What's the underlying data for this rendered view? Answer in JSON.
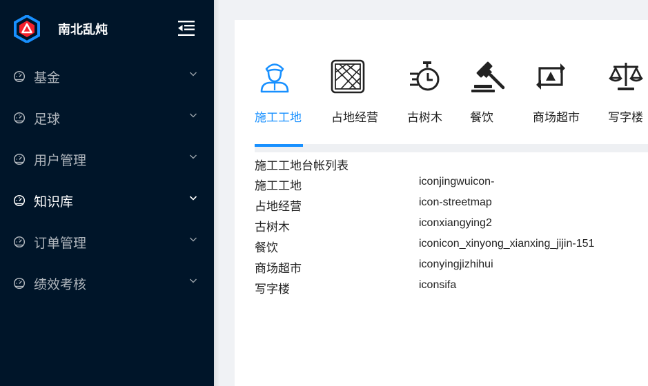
{
  "app": {
    "title": "南北乱炖"
  },
  "sidebar": {
    "items": [
      {
        "label": "基金",
        "active": false
      },
      {
        "label": "足球",
        "active": false
      },
      {
        "label": "用户管理",
        "active": false
      },
      {
        "label": "知识库",
        "active": true
      },
      {
        "label": "订单管理",
        "active": false
      },
      {
        "label": "绩效考核",
        "active": false
      }
    ]
  },
  "tabs": [
    {
      "label": "施工工地",
      "icon": "worker-icon",
      "active": true
    },
    {
      "label": "占地经营",
      "icon": "street-map-icon",
      "active": false
    },
    {
      "label": "古树木",
      "icon": "stopwatch-icon",
      "active": false
    },
    {
      "label": "餐饮",
      "icon": "gavel-icon",
      "active": false
    },
    {
      "label": "商场超市",
      "icon": "cycle-arrows-icon",
      "active": false
    },
    {
      "label": "写字楼",
      "icon": "scales-icon",
      "active": false
    }
  ],
  "table": {
    "title": "施工工地台帐列表",
    "rows": [
      {
        "name": "施工工地",
        "icon_class": "iconjingwuicon-"
      },
      {
        "name": "占地经营",
        "icon_class": "icon-streetmap"
      },
      {
        "name": "古树木",
        "icon_class": "iconxiangying2"
      },
      {
        "name": "餐饮",
        "icon_class": "iconicon_xinyong_xianxing_jijin-151"
      },
      {
        "name": "商场超市",
        "icon_class": "iconyingjizhihui"
      },
      {
        "name": "写字楼",
        "icon_class": "iconsifa"
      }
    ]
  },
  "colors": {
    "sidebar_bg": "#001529",
    "accent": "#1890ff",
    "logo_blue": "#1890ff",
    "logo_red": "#f5222d"
  }
}
